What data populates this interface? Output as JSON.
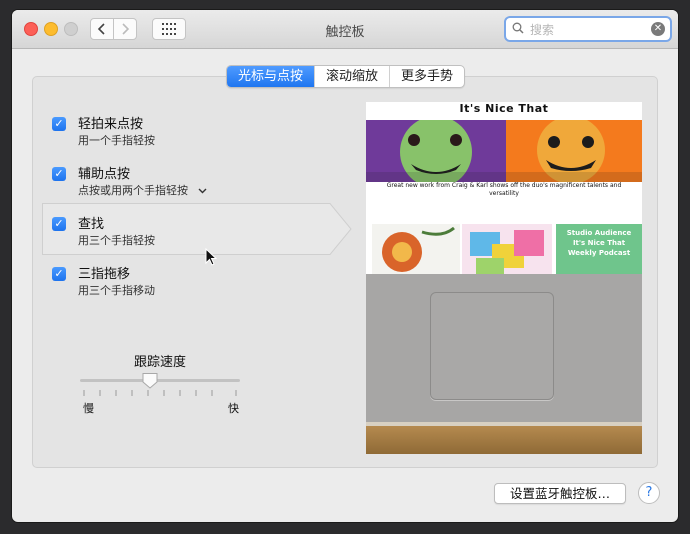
{
  "window": {
    "title": "触控板"
  },
  "search": {
    "value": "",
    "placeholder": "搜索"
  },
  "tabs": [
    {
      "label": "光标与点按",
      "active": true
    },
    {
      "label": "滚动缩放",
      "active": false
    },
    {
      "label": "更多手势",
      "active": false
    }
  ],
  "options": [
    {
      "title": "轻拍来点按",
      "subtitle": "用一个手指轻按",
      "checked": true
    },
    {
      "title": "辅助点按",
      "subtitle": "点按或用两个手指轻按",
      "checked": true,
      "has_dropdown": true
    },
    {
      "title": "查找",
      "subtitle": "用三个手指轻按",
      "checked": true,
      "highlighted": true
    },
    {
      "title": "三指拖移",
      "subtitle": "用三个手指移动",
      "checked": true
    }
  ],
  "tracking_speed": {
    "label": "跟踪速度",
    "min_label": "慢",
    "max_label": "快",
    "value": 0.44
  },
  "preview": {
    "site_title": "It's Nice That",
    "caption": "Great new work from Craig & Karl shows off the duo's magnificent talents and versatility",
    "card_text": [
      "Studio Audience",
      "It's Nice That",
      "Weekly Podcast"
    ]
  },
  "footer": {
    "bluetooth_button": "设置蓝牙触控板…",
    "help": "?"
  },
  "colors": {
    "accent": "#1f76f0",
    "checkbox": "#2a82f5"
  },
  "icons": {
    "back": "chevron-left-icon",
    "forward": "chevron-right-icon",
    "grid": "grid-icon",
    "search": "search-icon",
    "clear": "clear-icon"
  }
}
